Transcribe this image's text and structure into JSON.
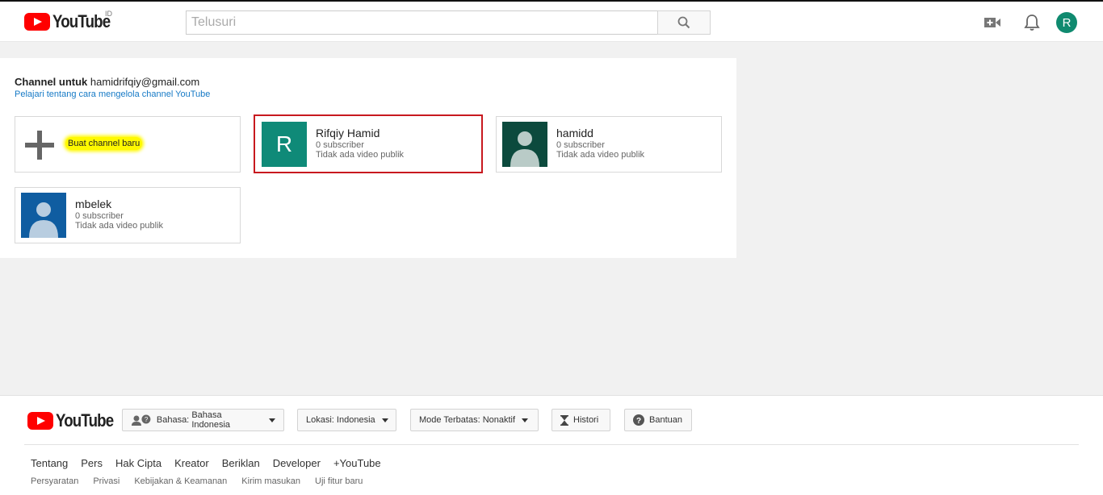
{
  "header": {
    "logo_text": "YouTube",
    "country_code": "ID",
    "search_placeholder": "Telusuri",
    "avatar_letter": "R"
  },
  "panel": {
    "title_prefix": "Channel untuk",
    "email": "hamidrifqiy@gmail.com",
    "learn_link": "Pelajari tentang cara mengelola channel YouTube",
    "create_label": "Buat channel baru",
    "channels": [
      {
        "name": "Rifqiy Hamid",
        "subs": "0 subscriber",
        "videos": "Tidak ada video publik",
        "avatar_letter": "R",
        "color": "#0f8a78"
      },
      {
        "name": "hamidd",
        "subs": "0 subscriber",
        "videos": "Tidak ada video publik",
        "color": "#0c4a3d"
      },
      {
        "name": "mbelek",
        "subs": "0 subscriber",
        "videos": "Tidak ada video publik",
        "color": "#0f5da1"
      }
    ]
  },
  "footer": {
    "logo_text": "YouTube",
    "language_label": "Bahasa:",
    "language_value": "Bahasa Indonesia",
    "location_label": "Lokasi:",
    "location_value": "Indonesia",
    "restricted_label": "Mode Terbatas:",
    "restricted_value": "Nonaktif",
    "history": "Histori",
    "help": "Bantuan",
    "links_primary": [
      "Tentang",
      "Pers",
      "Hak Cipta",
      "Kreator",
      "Beriklan",
      "Developer",
      "+YouTube"
    ],
    "links_secondary": [
      "Persyaratan",
      "Privasi",
      "Kebijakan & Keamanan",
      "Kirim masukan",
      "Uji fitur baru"
    ]
  }
}
